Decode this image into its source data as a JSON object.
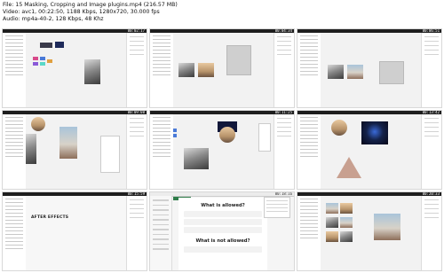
{
  "header": {
    "file_line": "File: 15  Masking, Cropping and Image plugins.mp4 (216.57 MB)",
    "video_line": "Video: avc1, 00:22:50, 1188 Kbps, 1280x720, 30.000 fps",
    "audio_line": "Audio: mp4a-40-2, 128 Kbps, 48 Khz"
  },
  "thumbnails": [
    {
      "timestamp": "00:02:17"
    },
    {
      "timestamp": "00:04:34"
    },
    {
      "timestamp": "00:06:51"
    },
    {
      "timestamp": "00:09:08"
    },
    {
      "timestamp": "00:11:25"
    },
    {
      "timestamp": "00:13:42"
    },
    {
      "timestamp": "00:15:59",
      "canvas_title": "AFTER EFFECTS"
    },
    {
      "timestamp": "00:18:16",
      "heading_allowed": "What is allowed?",
      "heading_not_allowed": "What is not allowed?"
    },
    {
      "timestamp": "00:20:33"
    }
  ],
  "colors": {
    "dark_bar": "#1e1e1e",
    "canvas": "#f2f2f2",
    "accent_green": "#2f7d4a"
  }
}
